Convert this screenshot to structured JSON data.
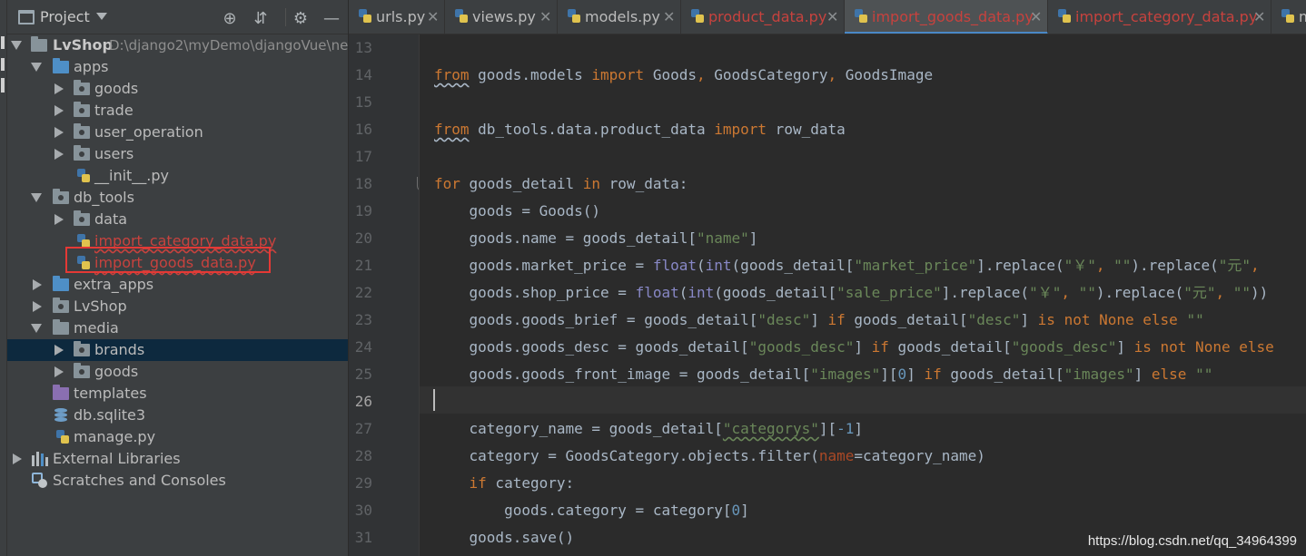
{
  "panel": {
    "title": "Project",
    "buttons": [
      "locate-icon",
      "collapse-icon",
      "gear-icon",
      "hide-icon"
    ]
  },
  "tree": [
    {
      "label": "LvShop",
      "hint": "D:\\django2\\myDemo\\djangoVue\\ne",
      "type": "folder",
      "bold": true
    },
    {
      "label": "apps",
      "type": "folder-blue"
    },
    {
      "label": "goods",
      "type": "package"
    },
    {
      "label": "trade",
      "type": "package"
    },
    {
      "label": "user_operation",
      "type": "package"
    },
    {
      "label": "users",
      "type": "package"
    },
    {
      "label": "__init__.py",
      "type": "python-file"
    },
    {
      "label": "db_tools",
      "type": "package"
    },
    {
      "label": "data",
      "type": "package"
    },
    {
      "label": "import_category_data.py",
      "type": "python-file",
      "error": true
    },
    {
      "label": "import_goods_data.py",
      "type": "python-file",
      "error": true
    },
    {
      "label": "extra_apps",
      "type": "folder-blue"
    },
    {
      "label": "LvShop",
      "type": "package"
    },
    {
      "label": "media",
      "type": "folder"
    },
    {
      "label": "brands",
      "type": "package",
      "selected": true
    },
    {
      "label": "goods",
      "type": "package"
    },
    {
      "label": "templates",
      "type": "folder-purple"
    },
    {
      "label": "db.sqlite3",
      "type": "database-file"
    },
    {
      "label": "manage.py",
      "type": "python-file"
    },
    {
      "label": "External Libraries",
      "type": "library"
    },
    {
      "label": "Scratches and Consoles",
      "type": "scratch"
    }
  ],
  "tabs": [
    {
      "label": "urls.py"
    },
    {
      "label": "views.py"
    },
    {
      "label": "models.py"
    },
    {
      "label": "product_data.py",
      "error": true
    },
    {
      "label": "import_goods_data.py",
      "error": true,
      "active": true
    },
    {
      "label": "import_category_data.py",
      "error": true
    },
    {
      "label": "m"
    }
  ],
  "editor": {
    "line_numbers": [
      "13",
      "14",
      "15",
      "16",
      "17",
      "18",
      "19",
      "20",
      "21",
      "22",
      "23",
      "24",
      "25",
      "26",
      "27",
      "28",
      "29",
      "30",
      "31"
    ],
    "current_line": "26"
  },
  "watermark": "https://blog.csdn.net/qq_34964399",
  "colors": {
    "keyword": "#cc7832",
    "string": "#6a8759",
    "number": "#6897bb",
    "builtin": "#8888c6",
    "error_file": "#c7423e",
    "selection": "#0d293e",
    "highlight_box": "#e53935"
  }
}
